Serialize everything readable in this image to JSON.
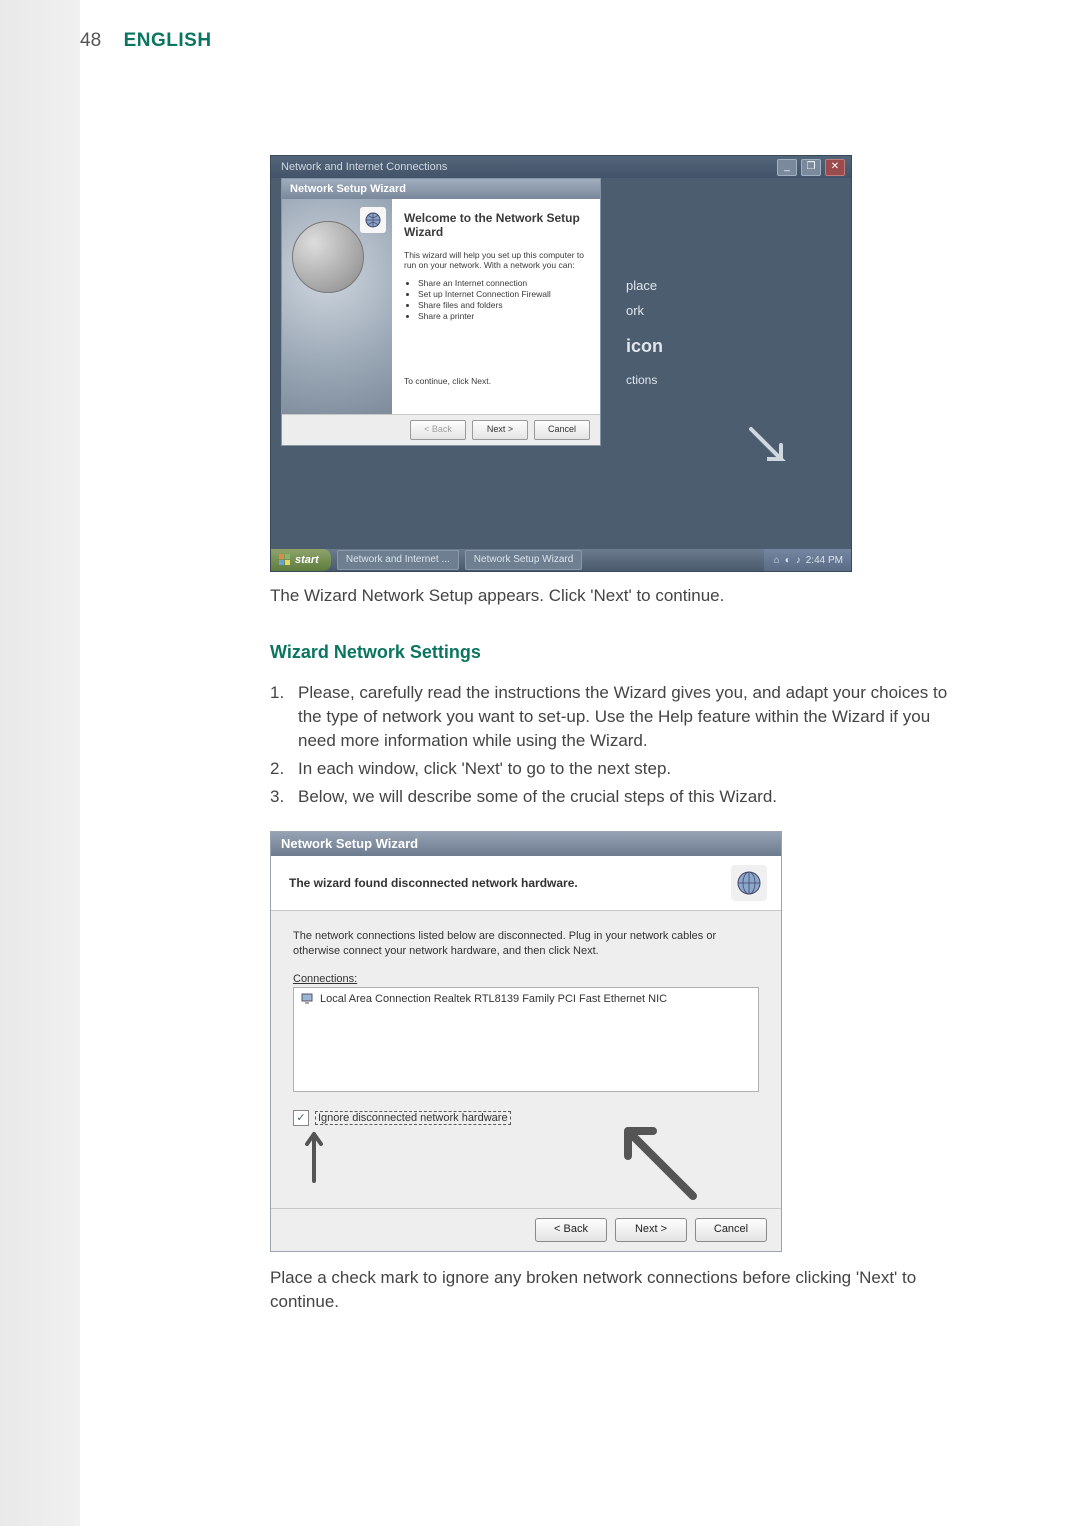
{
  "header": {
    "page_number": "48",
    "title": "ENGLISH"
  },
  "shot1": {
    "outer_title": "Network and Internet Connections",
    "winbtns": {
      "min": "_",
      "max": "❐",
      "close": "✕"
    },
    "right_pane": {
      "l1": "place",
      "l2": "ork",
      "l3": "icon",
      "l4": "ctions"
    },
    "taskbar": {
      "start": "start",
      "item1": "Network and Internet ...",
      "item2": "Network Setup Wizard",
      "clock": "2:44 PM"
    },
    "wizard": {
      "titlebar": "Network Setup Wizard",
      "welcome_title": "Welcome to the Network Setup Wizard",
      "intro": "This wizard will help you set up this computer to run on your network. With a network you can:",
      "bullets": [
        "Share an Internet connection",
        "Set up Internet Connection Firewall",
        "Share files and folders",
        "Share a printer"
      ],
      "continue": "To continue, click Next.",
      "btn_back": "< Back",
      "btn_next": "Next >",
      "btn_cancel": "Cancel"
    }
  },
  "caption1": "The Wizard Network Setup appears. Click 'Next' to continue.",
  "subhead": "Wizard Network Settings",
  "steps": [
    "Please, carefully read the instructions the Wizard gives you, and adapt your choices to the type of network you want to set-up. Use the Help feature within the Wizard if you need more information while using the Wizard.",
    "In each window, click 'Next' to go to the next step.",
    "Below, we will describe some of the crucial steps of this Wizard."
  ],
  "shot2": {
    "titlebar": "Network Setup Wizard",
    "heading": "The wizard found disconnected network hardware.",
    "desc": "The network connections listed below are disconnected. Plug in your network cables or otherwise connect your network hardware, and then click Next.",
    "conn_label": "Connections:",
    "conn_item": "Local Area Connection    Realtek RTL8139 Family PCI Fast Ethernet NIC",
    "checkbox_label": "Ignore disconnected network hardware",
    "btn_back": "< Back",
    "btn_next": "Next >",
    "btn_cancel": "Cancel"
  },
  "caption2": "Place a check mark to ignore any broken network connections before clicking 'Next' to continue."
}
